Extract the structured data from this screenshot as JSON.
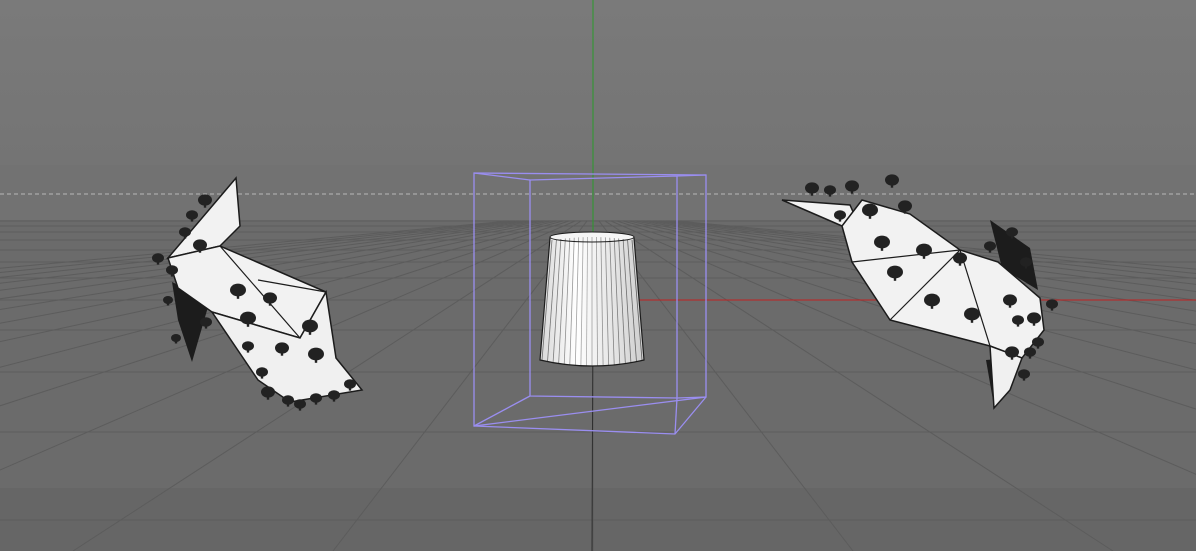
{
  "viewport": {
    "view": "perspective",
    "background": {
      "sky_top": "#7a7a7a",
      "sky_bottom": "#747474",
      "floor": "#6b6b6b",
      "floor_far": "#727272"
    },
    "colors": {
      "grid_line": "#5c5c5c",
      "horizon_dashed": "#b8b8b8",
      "axis_x": "#c02020",
      "axis_y": "#2a9a2a",
      "axis_z": "#2f2f2f",
      "selection_box": "#9a8ef0",
      "model_fill": "#f2f2f2",
      "model_dark": "#1c1c1c",
      "spot": "#222222"
    },
    "objects": [
      {
        "name": "origami-model-left",
        "type": "mesh",
        "selected": false
      },
      {
        "name": "tapered-cylinder",
        "type": "mesh",
        "selected": true
      },
      {
        "name": "origami-model-right",
        "type": "mesh",
        "selected": false
      }
    ]
  }
}
